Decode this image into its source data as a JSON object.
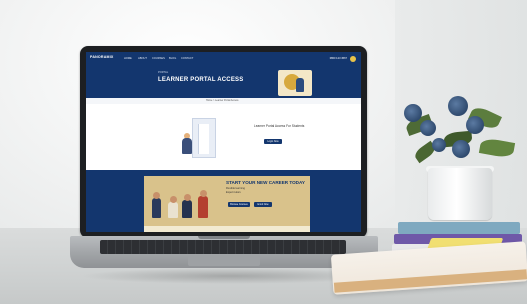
{
  "scene": {
    "description": ""
  },
  "website": {
    "nav": {
      "logo": "PANORAMIX",
      "items": [
        "HOME",
        "ABOUT",
        "COURSES",
        "BLOG",
        "CONTACT"
      ],
      "phone": "0800 123 4567"
    },
    "hero": {
      "kicker": "PORTAL",
      "title": "LEARNER PORTAL ACCESS"
    },
    "breadcrumb": "Home > Learner Portal Access",
    "portal": {
      "text": "Learner Portal Access For Students",
      "button": "Login Now"
    },
    "career": {
      "title": "START YOUR NEW CAREER TODAY",
      "list": [
        "Flexible learning",
        "Expert tutors",
        "Accredited courses",
        "Career support"
      ],
      "buttons": [
        "Browse Courses",
        "Enrol Now"
      ]
    }
  }
}
